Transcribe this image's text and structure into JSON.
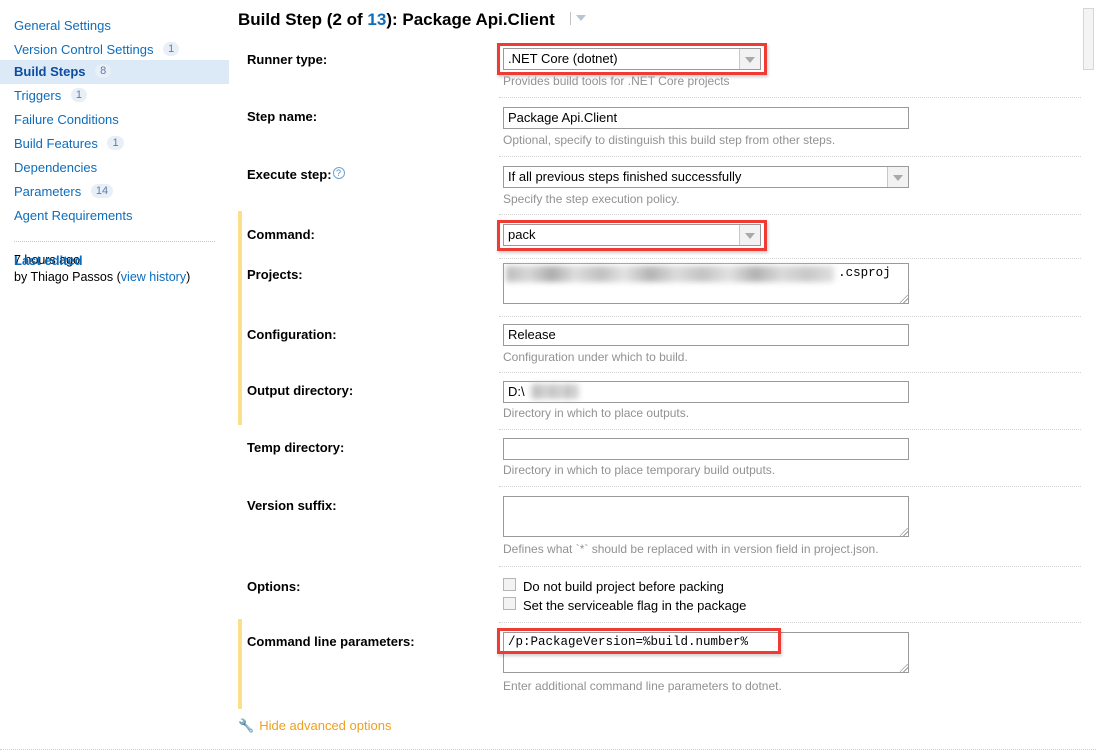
{
  "sidebar": {
    "items": [
      {
        "label": "General Settings",
        "count": "",
        "active": false
      },
      {
        "label": "Version Control Settings",
        "count": "1",
        "active": false
      },
      {
        "label": "Build Steps",
        "count": "8",
        "active": true
      },
      {
        "label": "Triggers",
        "count": "1",
        "active": false
      },
      {
        "label": "Failure Conditions",
        "count": "",
        "active": false
      },
      {
        "label": "Build Features",
        "count": "1",
        "active": false
      },
      {
        "label": "Dependencies",
        "count": "",
        "active": false
      },
      {
        "label": "Parameters",
        "count": "14",
        "active": false
      },
      {
        "label": "Agent Requirements",
        "count": "",
        "active": false
      }
    ],
    "last_edited": {
      "label": "Last edited",
      "time": "7 hours ago",
      "by_prefix": "by",
      "author": "Thiago Passos",
      "history_link": "view history"
    }
  },
  "header": {
    "title_prefix": "Build Step (2 of ",
    "title_total": "13",
    "title_suffix": "): Package Api.Client"
  },
  "form": {
    "runner_type": {
      "label": "Runner type:",
      "value": ".NET Core (dotnet)",
      "hint": "Provides build tools for .NET Core projects",
      "highlighted": true
    },
    "step_name": {
      "label": "Step name:",
      "value": "Package Api.Client",
      "hint": "Optional, specify to distinguish this build step from other steps."
    },
    "execute_step": {
      "label": "Execute step:",
      "value": "If all previous steps finished successfully",
      "hint": "Specify the step execution policy.",
      "help_glyph": "?"
    },
    "command": {
      "label": "Command:",
      "value": "pack",
      "highlighted": true,
      "modified": true
    },
    "projects": {
      "label": "Projects:",
      "value_redacted": true,
      "value_visible_tail": ".csproj",
      "modified": true
    },
    "configuration": {
      "label": "Configuration:",
      "value": "Release",
      "hint": "Configuration under which to build.",
      "modified": true
    },
    "output_directory": {
      "label": "Output directory:",
      "value_prefix": "D:\\",
      "value_redacted": true,
      "hint": "Directory in which to place outputs.",
      "modified": true
    },
    "temp_directory": {
      "label": "Temp directory:",
      "value": "",
      "hint": "Directory in which to place temporary build outputs."
    },
    "version_suffix": {
      "label": "Version suffix:",
      "value": "",
      "hint": "Defines what `*` should be replaced with in version field in project.json."
    },
    "options": {
      "label": "Options:",
      "checkboxes": [
        {
          "label": "Do not build project before packing",
          "checked": false
        },
        {
          "label": "Set the serviceable flag in the package",
          "checked": false
        }
      ]
    },
    "command_line_parameters": {
      "label": "Command line parameters:",
      "value": "/p:PackageVersion=%build.number%",
      "hint": "Enter additional command line parameters to dotnet.",
      "highlighted": true,
      "modified": true
    }
  },
  "footer": {
    "advanced_toggle": "Hide advanced options",
    "wrench_glyph": "🔧"
  },
  "colors": {
    "link": "#0c6dbd",
    "active_bg": "#dce9f7",
    "highlight_red": "#ef3b34",
    "modified_marker": "#fbdf8d",
    "hint_gray": "#929292",
    "orange": "#f0a01e"
  }
}
